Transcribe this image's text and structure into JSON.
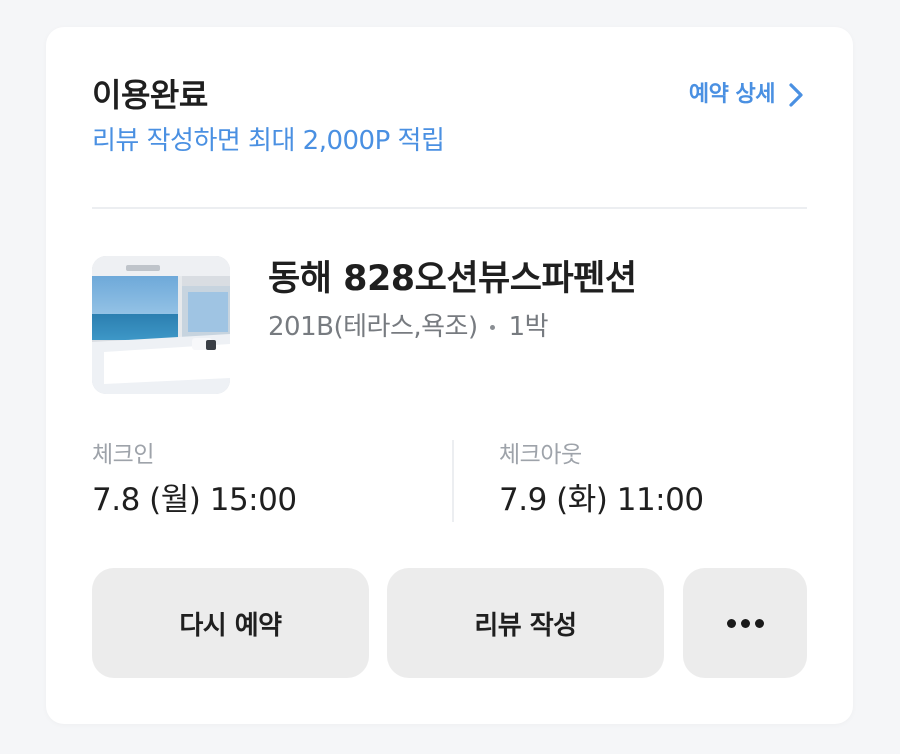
{
  "booking": {
    "status": "이용완료",
    "review_reward": "리뷰 작성하면 최대 2,000P 적립",
    "detail_link": "예약 상세"
  },
  "property": {
    "name": "동해 828오션뷰스파펜션",
    "room": "201B(테라스,욕조)",
    "nights": "1박"
  },
  "schedule": {
    "checkin_label": "체크인",
    "checkin_value": "7.8 (월) 15:00",
    "checkout_label": "체크아웃",
    "checkout_value": "7.9 (화) 11:00"
  },
  "actions": {
    "rebook": "다시 예약",
    "write_review": "리뷰 작성",
    "more_icon": "more-horizontal-icon"
  },
  "colors": {
    "accent": "#4a90e2",
    "button_bg": "#ececec",
    "muted_label": "#9ea3aa"
  }
}
